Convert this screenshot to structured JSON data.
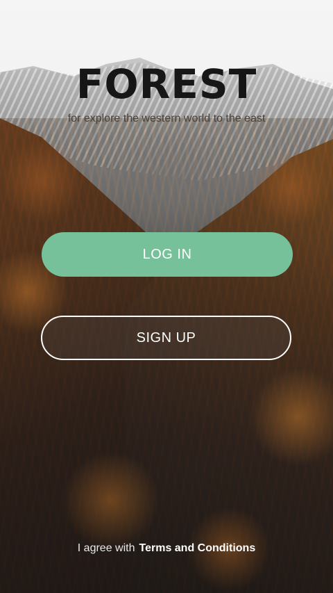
{
  "app": {
    "title": "FOREST",
    "tagline": "for explore the western world to the east"
  },
  "actions": {
    "login_label": "LOG IN",
    "signup_label": "SIGN UP"
  },
  "footer": {
    "agree_text": "I agree with",
    "terms_link": "Terms and Conditions"
  },
  "colors": {
    "primary_button": "#76c09a",
    "title_text": "#161616",
    "outline_button_border": "#ffffff"
  }
}
